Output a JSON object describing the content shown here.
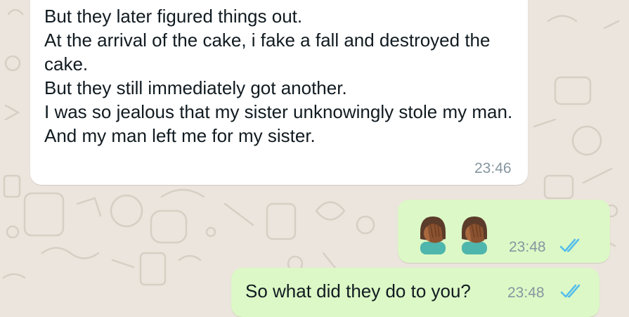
{
  "chat": {
    "incoming_message": {
      "text": "But they later figured things out.\nAt the arrival of the cake, i fake a fall and destroyed the cake.\nBut they still immediately got another.\nI was so jealous that my sister unknowingly stole my man.\nAnd my man left me for my sister.",
      "time": "23:46"
    },
    "outgoing_emoji_message": {
      "emojis": [
        "face-palm-emoji",
        "face-palm-emoji"
      ],
      "time": "23:48",
      "status": "read"
    },
    "outgoing_text_message": {
      "text": "So what did they do to you?",
      "time": "23:48",
      "status": "read"
    }
  },
  "colors": {
    "wallpaper": "#ece5dd",
    "incoming_bubble": "#ffffff",
    "outgoing_bubble": "#dcf8c6",
    "read_ticks": "#53bdeb",
    "timestamp": "#8696a0"
  }
}
